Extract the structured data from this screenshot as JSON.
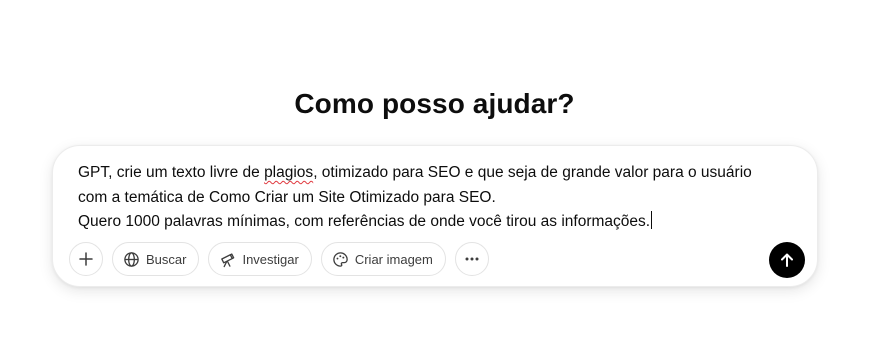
{
  "heading": "Como posso ajudar?",
  "prompt": {
    "line1_before": "GPT, crie um texto livre de ",
    "line1_misspelled": "plagios",
    "line1_after": ", otimizado para SEO e que seja de grande valor para o usuário",
    "line2": "com a temática de Como Criar um Site Otimizado para SEO.",
    "line3": "Quero 1000 palavras mínimas, com referências de onde você tirou as informações."
  },
  "toolbar": {
    "buscar_label": "Buscar",
    "investigar_label": "Investigar",
    "criar_imagem_label": "Criar imagem"
  },
  "icons": {
    "add": "plus-icon",
    "buscar": "globe-icon",
    "investigar": "telescope-icon",
    "criar_imagem": "palette-icon",
    "more": "ellipsis-icon",
    "send": "arrow-up-icon"
  },
  "colors": {
    "send_button": "#000000",
    "spell_underline": "#e0383e"
  }
}
